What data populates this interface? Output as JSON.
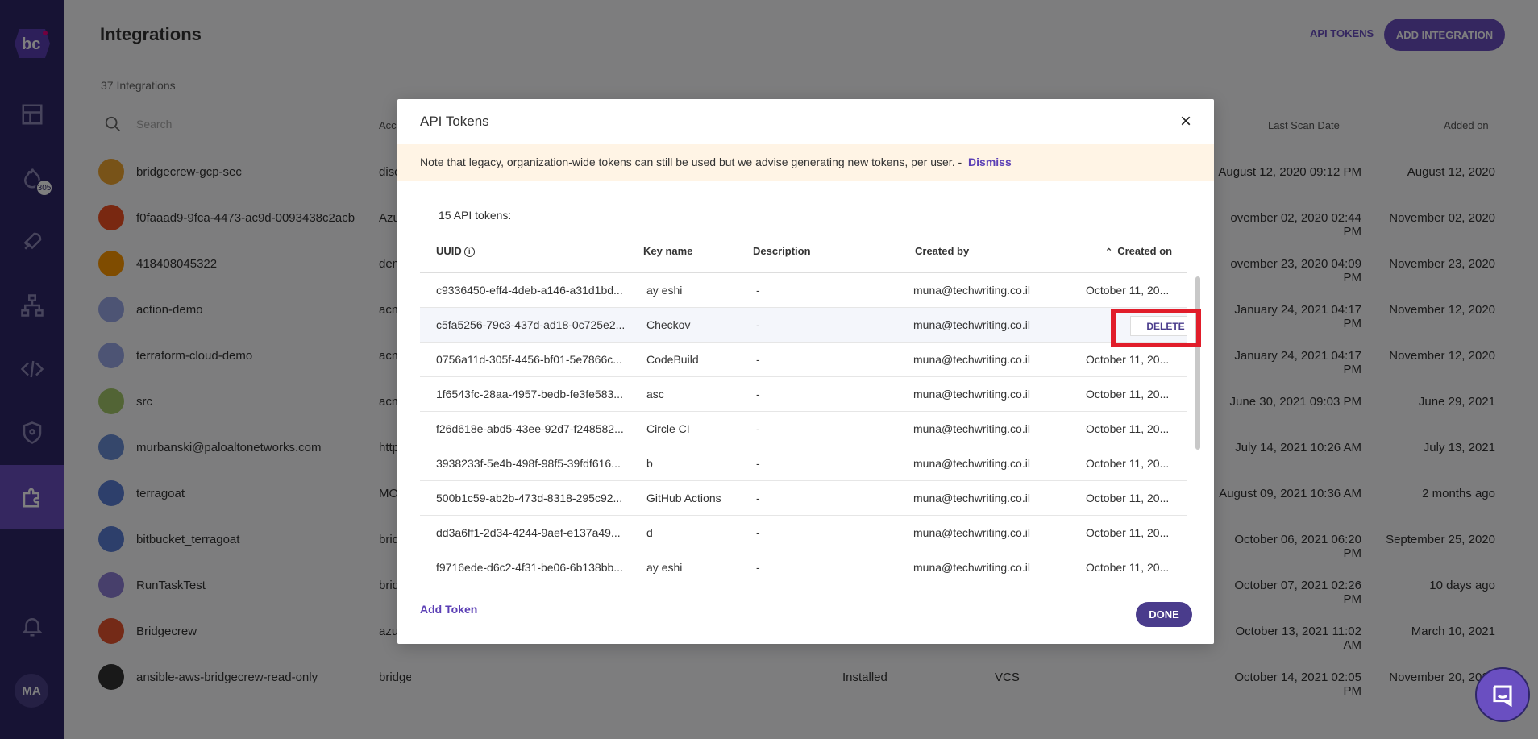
{
  "sidebar": {
    "logo_text": "bc",
    "badge_count": "305",
    "avatar_initials": "MA",
    "items": [
      {
        "icon": "dashboard-icon"
      },
      {
        "icon": "incidents-icon"
      },
      {
        "icon": "rocket-icon"
      },
      {
        "icon": "network-icon"
      },
      {
        "icon": "code-icon"
      },
      {
        "icon": "shield-icon"
      },
      {
        "icon": "puzzle-icon",
        "active": true
      },
      {
        "icon": "bell-icon"
      }
    ]
  },
  "page": {
    "title": "Integrations",
    "api_tokens_link": "API TOKENS",
    "add_integration": "ADD INTEGRATION",
    "integrations_count": "37 Integrations",
    "search_placeholder": "Search",
    "col_account": "Acc",
    "col_last_scan": "Last Scan Date",
    "col_added_on": "Added on",
    "rows": [
      {
        "name": "bridgecrew-gcp-sec",
        "account": "disc",
        "status": "",
        "type": "",
        "last_scan": "August 12, 2020 09:12 PM",
        "added": "August 12, 2020"
      },
      {
        "name": "f0faaad9-9fca-4473-ac9d-0093438c2acb",
        "account": "Azu",
        "status": "",
        "type": "",
        "last_scan": "ovember 02, 2020 02:44 PM",
        "added": "November 02, 2020"
      },
      {
        "name": "418408045322",
        "account": "dem",
        "status": "",
        "type": "",
        "last_scan": "ovember 23, 2020 04:09 PM",
        "added": "November 23, 2020"
      },
      {
        "name": "action-demo",
        "account": "acm",
        "status": "",
        "type": "",
        "last_scan": "January 24, 2021 04:17 PM",
        "added": "November 12, 2020"
      },
      {
        "name": "terraform-cloud-demo",
        "account": "acm",
        "status": "",
        "type": "",
        "last_scan": "January 24, 2021 04:17 PM",
        "added": "November 12, 2020"
      },
      {
        "name": "src",
        "account": "acm",
        "status": "",
        "type": "",
        "last_scan": "June 30, 2021 09:03 PM",
        "added": "June 29, 2021"
      },
      {
        "name": "murbanski@paloaltonetworks.com",
        "account": "http",
        "status": "",
        "type": "",
        "last_scan": "July 14, 2021 10:26 AM",
        "added": "July 13, 2021"
      },
      {
        "name": "terragoat",
        "account": "MO",
        "status": "",
        "type": "",
        "last_scan": "August 09, 2021 10:36 AM",
        "added": "2 months ago"
      },
      {
        "name": "bitbucket_terragoat",
        "account": "brid",
        "status": "",
        "type": "",
        "last_scan": "October 06, 2021 06:20 PM",
        "added": "September 25, 2020"
      },
      {
        "name": "RunTaskTest",
        "account": "brid",
        "status": "",
        "type": "",
        "last_scan": "October 07, 2021 02:26 PM",
        "added": "10 days ago"
      },
      {
        "name": "Bridgecrew",
        "account": "azu",
        "status": "",
        "type": "",
        "last_scan": "October 13, 2021 11:02 AM",
        "added": "March 10, 2021"
      },
      {
        "name": "ansible-aws-bridgecrew-read-only",
        "account": "bridgecrewio",
        "status": "Installed",
        "type": "VCS",
        "last_scan": "October 14, 2021 02:05 PM",
        "added": "November 20, 2020"
      }
    ]
  },
  "modal": {
    "title": "API Tokens",
    "close_symbol": "×",
    "notice_text": "Note that legacy, organization-wide tokens can still be used but we advise generating new tokens, per user. -",
    "dismiss_label": "Dismiss",
    "token_count": "15 API tokens:",
    "headers": {
      "uuid": "UUID",
      "key_name": "Key name",
      "description": "Description",
      "created_by": "Created by",
      "created_on": "Created on"
    },
    "delete_label": "DELETE",
    "add_token_label": "Add Token",
    "done_label": "DONE",
    "rows": [
      {
        "uuid": "c9336450-eff4-4deb-a146-a31d1bd...",
        "key": "ay eshi",
        "desc": "-",
        "by": "muna@techwriting.co.il",
        "on": "October 11, 20..."
      },
      {
        "uuid": "c5fa5256-79c3-437d-ad18-0c725e2...",
        "key": "Checkov",
        "desc": "-",
        "by": "muna@techwriting.co.il",
        "on": ""
      },
      {
        "uuid": "0756a11d-305f-4456-bf01-5e7866c...",
        "key": "CodeBuild",
        "desc": "-",
        "by": "muna@techwriting.co.il",
        "on": "October 11, 20..."
      },
      {
        "uuid": "1f6543fc-28aa-4957-bedb-fe3fe583...",
        "key": "asc",
        "desc": "-",
        "by": "muna@techwriting.co.il",
        "on": "October 11, 20..."
      },
      {
        "uuid": "f26d618e-abd5-43ee-92d7-f248582...",
        "key": "Circle CI",
        "desc": "-",
        "by": "muna@techwriting.co.il",
        "on": "October 11, 20..."
      },
      {
        "uuid": "3938233f-5e4b-498f-98f5-39fdf616...",
        "key": "b",
        "desc": "-",
        "by": "muna@techwriting.co.il",
        "on": "October 11, 20..."
      },
      {
        "uuid": "500b1c59-ab2b-473d-8318-295c92...",
        "key": "GitHub Actions",
        "desc": "-",
        "by": "muna@techwriting.co.il",
        "on": "October 11, 20..."
      },
      {
        "uuid": "dd3a6ff1-2d34-4244-9aef-e137a49...",
        "key": "d",
        "desc": "-",
        "by": "muna@techwriting.co.il",
        "on": "October 11, 20..."
      },
      {
        "uuid": "f9716ede-d6c2-4f31-be06-6b138bb...",
        "key": "ay eshi",
        "desc": "-",
        "by": "muna@techwriting.co.il",
        "on": "October 11, 20..."
      }
    ]
  },
  "colors": {
    "sidebar": "#2f2668",
    "accent": "#6a4fc1",
    "highlight": "#e11d2a",
    "notice_bg": "#fff4e5"
  }
}
